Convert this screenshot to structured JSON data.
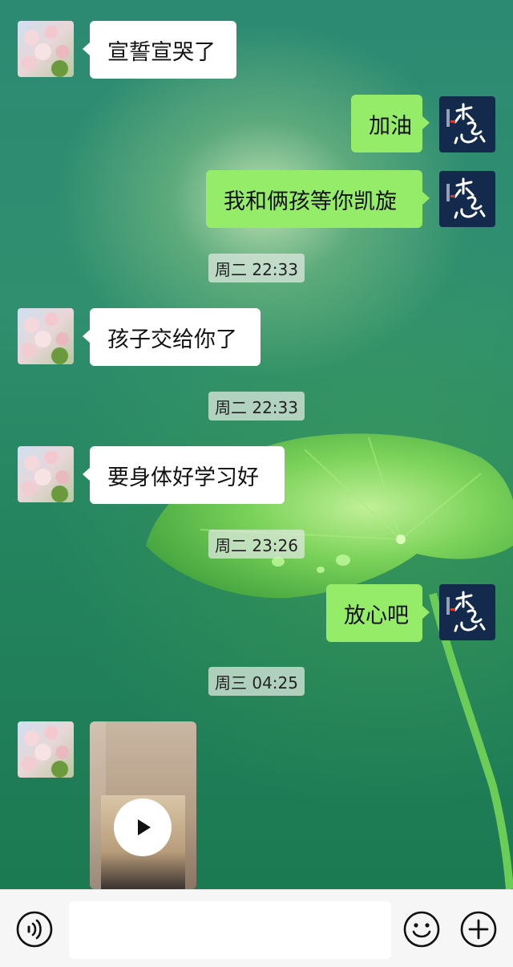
{
  "chat": {
    "messages": [
      {
        "side": "left",
        "type": "text",
        "text": "宣誓宣哭了"
      },
      {
        "side": "right",
        "type": "text",
        "text": "加油"
      },
      {
        "side": "right",
        "type": "text",
        "text": "我和俩孩等你凯旋"
      },
      {
        "type": "timestamp",
        "text": "周二 22:33"
      },
      {
        "side": "left",
        "type": "text",
        "text": "孩子交给你了"
      },
      {
        "type": "timestamp",
        "text": "周二 22:33"
      },
      {
        "side": "left",
        "type": "text",
        "text": "要身体好学习好"
      },
      {
        "type": "timestamp",
        "text": "周二 23:26"
      },
      {
        "side": "right",
        "type": "text",
        "text": "放心吧"
      },
      {
        "type": "timestamp",
        "text": "周三 04:25"
      },
      {
        "side": "left",
        "type": "video"
      }
    ]
  },
  "input_bar": {
    "voice_icon": "voice-icon",
    "emoji_icon": "emoji-icon",
    "add_icon": "plus-icon",
    "message_value": ""
  },
  "colors": {
    "outgoing_bubble": "#95ec69",
    "incoming_bubble": "#ffffff",
    "background": "#2f8f6e"
  }
}
